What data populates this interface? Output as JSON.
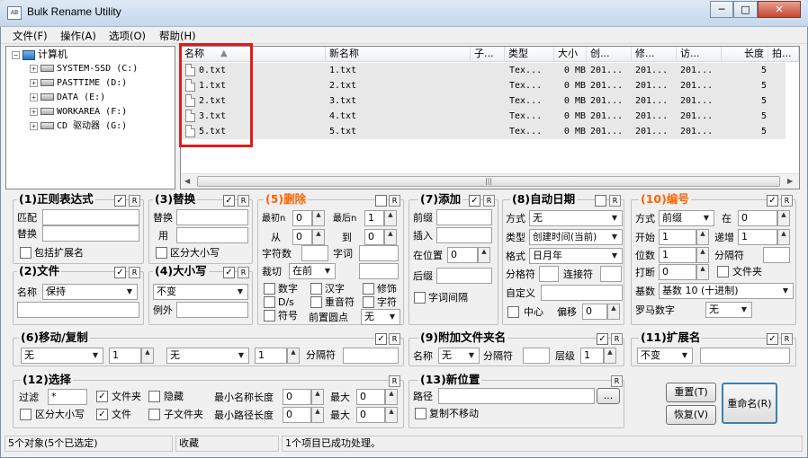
{
  "window": {
    "title": "Bulk Rename Utility",
    "app_icon_text": "AB",
    "btn_min": "─",
    "btn_max": "□",
    "btn_close": "✕"
  },
  "menu": [
    "文件(F)",
    "操作(A)",
    "选项(O)",
    "帮助(H)"
  ],
  "tree": {
    "root": "计算机",
    "drives": [
      "SYSTEM-SSD (C:)",
      "PASTTIME (D:)",
      "DATA (E:)",
      "WORKAREA (F:)",
      "CD 驱动器 (G:)"
    ]
  },
  "list": {
    "headers": [
      "名称",
      "新名称",
      "子...",
      "类型",
      "大小",
      "创...",
      "修...",
      "访...",
      "长度",
      "拍..."
    ],
    "rows": [
      {
        "name": "0.txt",
        "new": "1.txt",
        "type": "Tex...",
        "size": "0 MB",
        "c": "201...",
        "m": "201...",
        "a": "201...",
        "len": "5"
      },
      {
        "name": "1.txt",
        "new": "2.txt",
        "type": "Tex...",
        "size": "0 MB",
        "c": "201...",
        "m": "201...",
        "a": "201...",
        "len": "5"
      },
      {
        "name": "2.txt",
        "new": "3.txt",
        "type": "Tex...",
        "size": "0 MB",
        "c": "201...",
        "m": "201...",
        "a": "201...",
        "len": "5"
      },
      {
        "name": "3.txt",
        "new": "4.txt",
        "type": "Tex...",
        "size": "0 MB",
        "c": "201...",
        "m": "201...",
        "a": "201...",
        "len": "5"
      },
      {
        "name": "5.txt",
        "new": "5.txt",
        "type": "Tex...",
        "size": "0 MB",
        "c": "201...",
        "m": "201...",
        "a": "201...",
        "len": "5"
      }
    ],
    "scroll_grip": "|||"
  },
  "g1": {
    "title": "(1)正则表达式",
    "match": "匹配",
    "replace": "替换",
    "ext": "包括扩展名"
  },
  "g3": {
    "title": "(3)替换",
    "replace": "替换",
    "with": "用",
    "case": "区分大小写"
  },
  "g5": {
    "title": "(5)删除",
    "first_n": "最初n",
    "first_v": "0",
    "last_n": "最后n",
    "last_v": "1",
    "from": "从",
    "from_v": "0",
    "to": "到",
    "to_v": "0",
    "chars": "字符数",
    "words": "字词",
    "crop": "裁切",
    "crop_v": "在前",
    "digits": "数字",
    "hanzi": "汉字",
    "trim": "修饰",
    "ds": "D/s",
    "accent": "重音符",
    "word": "字符",
    "sym": "符号",
    "lead": "前置圆点",
    "lead_v": "无"
  },
  "g7": {
    "title": "(7)添加",
    "prefix": "前缀",
    "insert": "插入",
    "at": "在位置",
    "at_v": "0",
    "suffix": "后缀",
    "space": "字词间隔"
  },
  "g8": {
    "title": "(8)自动日期",
    "mode": "方式",
    "mode_v": "无",
    "type": "类型",
    "type_v": "创建时间(当前)",
    "fmt": "格式",
    "fmt_v": "日月年",
    "sep": "分格符",
    "con": "连接符",
    "custom": "自定义",
    "center": "中心",
    "offset": "偏移",
    "offset_v": "0"
  },
  "g10": {
    "title": "(10)编号",
    "mode": "方式",
    "mode_v": "前缀",
    "at": "在",
    "at_v": "0",
    "start": "开始",
    "start_v": "1",
    "incr": "递增",
    "incr_v": "1",
    "pad": "位数",
    "pad_v": "1",
    "sep": "分隔符",
    "brk": "打断",
    "brk_v": "0",
    "folder": "文件夹",
    "base": "基数",
    "base_v": "基数 10 (十进制)",
    "roman": "罗马数字",
    "roman_v": "无"
  },
  "g2": {
    "title": "(2)文件",
    "name": "名称",
    "name_v": "保持"
  },
  "g4": {
    "title": "(4)大小写",
    "case_v": "不变",
    "except": "例外"
  },
  "g6": {
    "title": "(6)移动/复制",
    "mode_v": "无",
    "n_v": "1",
    "mode2_v": "无",
    "n2_v": "1",
    "sep": "分隔符"
  },
  "g9": {
    "title": "(9)附加文件夹名",
    "name": "名称",
    "name_v": "无",
    "sep": "分隔符",
    "level": "层级",
    "level_v": "1"
  },
  "g11": {
    "title": "(11)扩展名",
    "ext_v": "不变"
  },
  "g12": {
    "title": "(12)选择",
    "filter": "过滤",
    "filter_v": "*",
    "folders": "文件夹",
    "hidden": "隐藏",
    "minname": "最小名称长度",
    "minname_v": "0",
    "max": "最大",
    "max_v": "0",
    "case": "区分大小写",
    "files": "文件",
    "subf": "子文件夹",
    "minpath": "最小路径长度",
    "minpath_v": "0",
    "max2_v": "0"
  },
  "g13": {
    "title": "(13)新位置",
    "path": "路径",
    "browse": "...",
    "copy": "复制不移动"
  },
  "buttons": {
    "reset": "重置(T)",
    "revert": "恢复(V)",
    "rename": "重命名(R)"
  },
  "status": {
    "left": "5个对象(5个已选定)",
    "mid": "收藏",
    "right": "1个项目已成功处理。"
  },
  "labels": {
    "r": "R",
    "check": "✓",
    "sort_arrow": "▲",
    "down": "▼",
    "up": "▲",
    "left": "◀",
    "right": "▶",
    "plus": "+",
    "minus": "−"
  }
}
